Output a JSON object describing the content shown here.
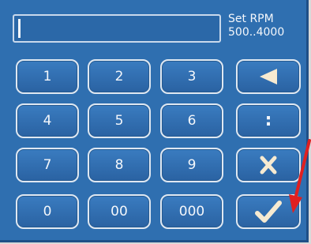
{
  "display": {
    "prompt_line1": "Set RPM",
    "prompt_line2": "500..4000"
  },
  "keys": [
    {
      "label": "1"
    },
    {
      "label": "2"
    },
    {
      "label": "3"
    },
    {
      "label": "4"
    },
    {
      "label": "5"
    },
    {
      "label": "6"
    },
    {
      "label": "7"
    },
    {
      "label": "8"
    },
    {
      "label": "9"
    },
    {
      "label": "0"
    },
    {
      "label": "00"
    },
    {
      "label": "000"
    }
  ],
  "function_keys": {
    "backspace_icon": "left-triangle-icon",
    "colon_label": ":",
    "cancel_icon": "x-icon",
    "confirm_icon": "checkmark-icon"
  },
  "colors": {
    "panel": "#2f6fb0",
    "key_border": "#dfe8f2",
    "annotation_arrow": "#e02020"
  }
}
